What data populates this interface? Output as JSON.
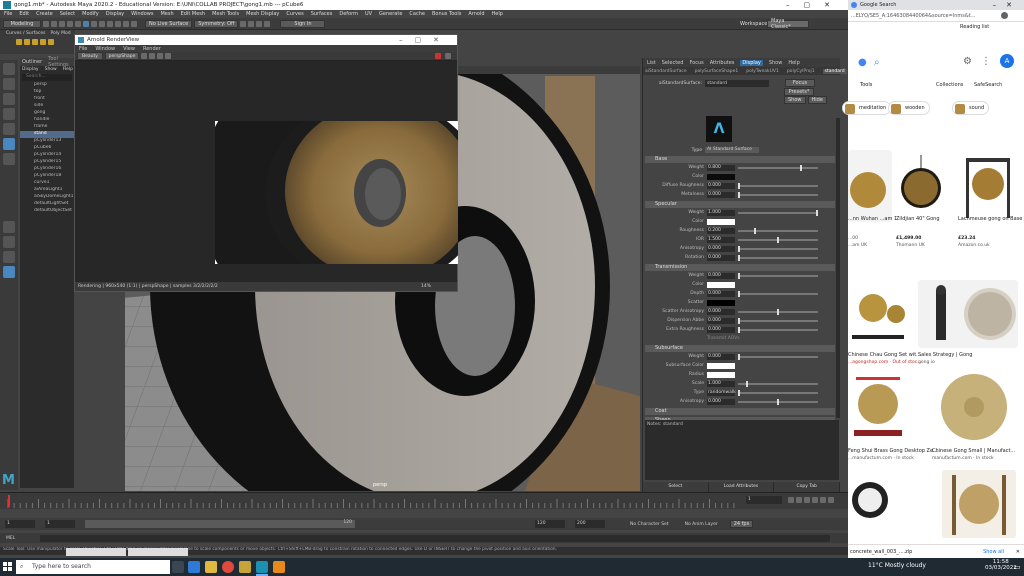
{
  "maya": {
    "title": "gong1.mb* - Autodesk Maya 2020.2 - Educational Version: E:\\UNI\\COLLAB PROJECT\\gong1.mb  ---  pCube6",
    "menu": [
      "File",
      "Edit",
      "Create",
      "Select",
      "Modify",
      "Display",
      "Windows",
      "Mesh",
      "Edit Mesh",
      "Mesh Tools",
      "Mesh Display",
      "Curves",
      "Surfaces",
      "Deform",
      "UV",
      "Generate",
      "Cache",
      "Bonus Tools",
      "Arnold",
      "Help"
    ],
    "workspace_label": "Workspace:",
    "workspace_value": "Maya Classic*",
    "mode_menu": "Modeling",
    "no_live_surface": "No Live Surface",
    "symmetry": "Symmetry: Off",
    "signin": "Sign In",
    "shelf_tab": "Curves / Surfaces",
    "shelf_tab2": "Poly Mod",
    "outliner_tabs": [
      "Outliner",
      "Tool Settings"
    ],
    "outliner_menu": [
      "Display",
      "Show",
      "Help"
    ],
    "outliner_search": "Search...",
    "outliner_items": [
      {
        "label": "persp",
        "selected": false
      },
      {
        "label": "top",
        "selected": false
      },
      {
        "label": "front",
        "selected": false
      },
      {
        "label": "side",
        "selected": false
      },
      {
        "label": "gong",
        "selected": false
      },
      {
        "label": "handle",
        "selected": false
      },
      {
        "label": "frame",
        "selected": false
      },
      {
        "label": "stand",
        "selected": true
      },
      {
        "label": "pCylinder13",
        "selected": false
      },
      {
        "label": "pCube6",
        "selected": false
      },
      {
        "label": "pCylinder14",
        "selected": false
      },
      {
        "label": "pCylinder15",
        "selected": false
      },
      {
        "label": "pCylinder16",
        "selected": false
      },
      {
        "label": "pCylinder18",
        "selected": false
      },
      {
        "label": "curve1",
        "selected": false
      },
      {
        "label": "aiAreaLight1",
        "selected": false
      },
      {
        "label": "aiSkyDomeLight1",
        "selected": false
      },
      {
        "label": "defaultLightSet",
        "selected": false
      },
      {
        "label": "defaultObjectSet",
        "selected": false
      }
    ],
    "viewport_label": "persp",
    "renderview": {
      "title": "Arnold RenderView",
      "menu": [
        "File",
        "Window",
        "View",
        "Render"
      ],
      "camera_menu": "Beauty",
      "persp_menu": "perspShape",
      "status": "Rendering | 960x540 (1:1) | perspShape | samples 3/2/2/2/2/2",
      "zoom": "14%"
    },
    "attr_menu": [
      "List",
      "Selected",
      "Focus",
      "Attributes",
      "Display",
      "Show",
      "Help"
    ],
    "attr_tabs": [
      "aiStandardSurface",
      "polySurfaceShape1",
      "polyTweakUV1",
      "polyCylProj1",
      "standard"
    ],
    "attr_surface_label": "aiStandardSurface:",
    "attr_surface_value": "standard",
    "focus_btn": "Focus",
    "presets_btn": "Presets*",
    "show_btn": "Show",
    "hide_btn": "Hide",
    "type_label": "Type",
    "type_value": "AI Standard Surface",
    "sections": {
      "base": {
        "title": "Base",
        "rows": [
          {
            "label": "Weight",
            "value": "0.800",
            "level": 0.8
          },
          {
            "label": "Color",
            "swatch": "#0c0c0c"
          },
          {
            "label": "Diffuse Roughness",
            "value": "0.000",
            "level": 0.0
          },
          {
            "label": "Metalness",
            "value": "0.000",
            "level": 0.0
          }
        ]
      },
      "specular": {
        "title": "Specular",
        "rows": [
          {
            "label": "Weight",
            "value": "1.000",
            "level": 1.0
          },
          {
            "label": "Color",
            "swatch": "#ffffff"
          },
          {
            "label": "Roughness",
            "value": "0.200",
            "level": 0.2
          },
          {
            "label": "IOR",
            "value": "1.500",
            "level": 0.5
          },
          {
            "label": "Anisotropy",
            "value": "0.000",
            "level": 0.0
          },
          {
            "label": "Rotation",
            "value": "0.000",
            "level": 0.0
          }
        ]
      },
      "transmission": {
        "title": "Transmission",
        "rows": [
          {
            "label": "Weight",
            "value": "0.000",
            "level": 0.0
          },
          {
            "label": "Color",
            "swatch": "#ffffff"
          },
          {
            "label": "Depth",
            "value": "0.000",
            "level": 0.0
          },
          {
            "label": "Scatter",
            "swatch": "#000000"
          },
          {
            "label": "Scatter Anisotropy",
            "value": "0.000",
            "level": 0.5
          },
          {
            "label": "Dispersion Abbe",
            "value": "0.000",
            "level": 0.0
          },
          {
            "label": "Extra Roughness",
            "value": "0.000",
            "level": 0.0
          }
        ]
      },
      "transmission_extra": "Transmit AOVs",
      "subsurface": {
        "title": "Subsurface",
        "rows": [
          {
            "label": "Weight",
            "value": "0.000",
            "level": 0.0
          },
          {
            "label": "Subsurface Color",
            "swatch": "#ffffff"
          },
          {
            "label": "Radius",
            "swatch": "#ffffff"
          },
          {
            "label": "Scale",
            "value": "1.000",
            "level": 0.1
          },
          {
            "label": "Type",
            "value": "randomwalk",
            "level": 0
          },
          {
            "label": "Anisotropy",
            "value": "0.000",
            "level": 0.5
          }
        ]
      },
      "coat": {
        "title": "Coat"
      },
      "sheen": {
        "title": "Sheen"
      }
    },
    "notes": "Notes: standard",
    "attr_footer": [
      "Select",
      "Load Attributes",
      "Copy Tab"
    ],
    "range_start": "1",
    "range_start2": "1",
    "range_mid": "120",
    "range_end": "120",
    "range_end2": "200",
    "current_frame": "1",
    "no_character_set": "No Character Set",
    "no_anim_layer": "No Anim Layer",
    "fps": "24 fps",
    "mel_label": "MEL",
    "help_text": "Scale Tool: Use manipulator to scale object(s). Ctrl+LMB-drag on manipulator axis/plane to scale components or move objects. Ctrl+Shift+LMB-drag to constrain rotation to connected edges. Use D or INSERT to change the pivot position and axis orientation."
  },
  "chrome": {
    "tab_title": "Google Search",
    "url": "...ELYQ/SE5_A:1646308440064&source=lnms&t...",
    "reading_list": "Reading list",
    "tools_label": "Tools",
    "collections_label": "Collections",
    "safesearch_label": "SafeSearch",
    "chips": [
      "meditation",
      "wooden",
      "sound"
    ],
    "results": [
      {
        "title": "...nn Wuhan ...am 130",
        "price": "...00",
        "store": "...am UK"
      },
      {
        "title": "Zildjian 40\" Gong",
        "price": "£1,499.00",
        "store": "Thomann UK"
      },
      {
        "title": "Lachmeuse gong on Base",
        "price": "£23.24",
        "store": "Amazon.co.uk"
      },
      {
        "title": "Chinese Chau Gong Set wit...",
        "store": "...agongshop.com · Out of stoc..."
      },
      {
        "title": "Sales Strategy | Gong",
        "store": "gong.io"
      },
      {
        "title": "Feng Shui Brass Gong Desktop Ze...",
        "store": "...manufactum.com · In stock"
      },
      {
        "title": "Chinese Gong Small | Manufact...",
        "store": "manufactum.com · In stock"
      }
    ],
    "download_file": "concrete_wall_003_....zip",
    "show_all": "Show all"
  },
  "taskbar": {
    "search_placeholder": "Type here to search",
    "weather": "11°C  Mostly cloudy",
    "time": "11:58",
    "date": "03/03/2022"
  }
}
